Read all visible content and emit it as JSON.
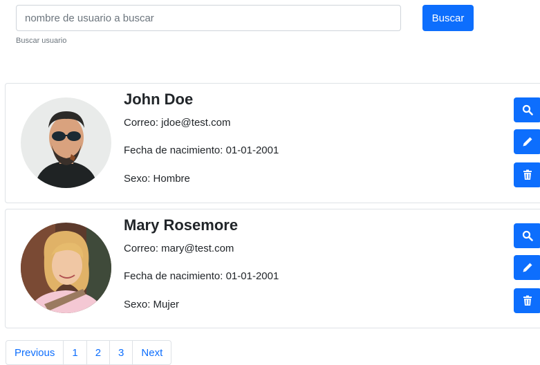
{
  "search": {
    "placeholder": "nombre de usuario a buscar",
    "help": "Buscar usuario",
    "button": "Buscar"
  },
  "users": [
    {
      "name": "John Doe",
      "email": "Correo: jdoe@test.com",
      "birth": "Fecha de nacimiento: 01-01-2001",
      "sex": "Sexo: Hombre"
    },
    {
      "name": "Mary Rosemore",
      "email": "Correo: mary@test.com",
      "birth": "Fecha de nacimiento: 01-01-2001",
      "sex": "Sexo: Mujer"
    }
  ],
  "pagination": {
    "previous": "Previous",
    "pages": [
      "1",
      "2",
      "3"
    ],
    "next": "Next"
  },
  "icons": {
    "view": "search-icon",
    "edit": "pencil-icon",
    "delete": "trash-icon"
  },
  "colors": {
    "primary": "#0d6efd",
    "border": "#dee2e6",
    "muted": "#6c757d"
  }
}
